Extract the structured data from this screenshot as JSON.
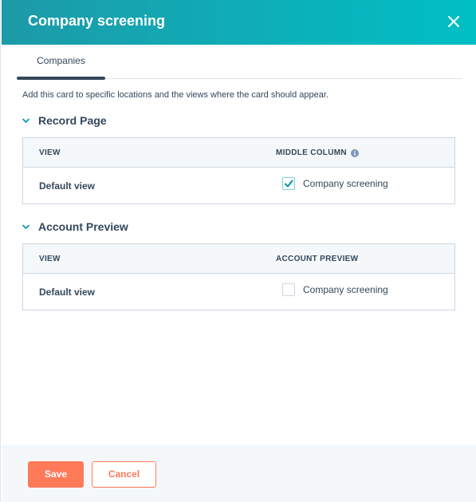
{
  "modal": {
    "title": "Company screening",
    "close_icon": "close-icon"
  },
  "tabs": [
    {
      "label": "Companies",
      "active": true
    }
  ],
  "description": "Add this card to specific locations and the views where the card should appear.",
  "sections": [
    {
      "title": "Record Page",
      "expanded": true,
      "columns": [
        "VIEW",
        "MIDDLE COLUMN"
      ],
      "has_info_icon": true,
      "rows": [
        {
          "view": "Default view",
          "option_label": "Company screening",
          "checked": true
        }
      ]
    },
    {
      "title": "Account Preview",
      "expanded": true,
      "columns": [
        "VIEW",
        "ACCOUNT PREVIEW"
      ],
      "has_info_icon": false,
      "rows": [
        {
          "view": "Default view",
          "option_label": "Company screening",
          "checked": false
        }
      ]
    }
  ],
  "footer": {
    "save_label": "Save",
    "cancel_label": "Cancel"
  },
  "colors": {
    "header_start": "#1d9aa8",
    "header_end": "#00bfc5",
    "accent": "#ff7a59",
    "text": "#33475b",
    "check": "#0091ae"
  }
}
